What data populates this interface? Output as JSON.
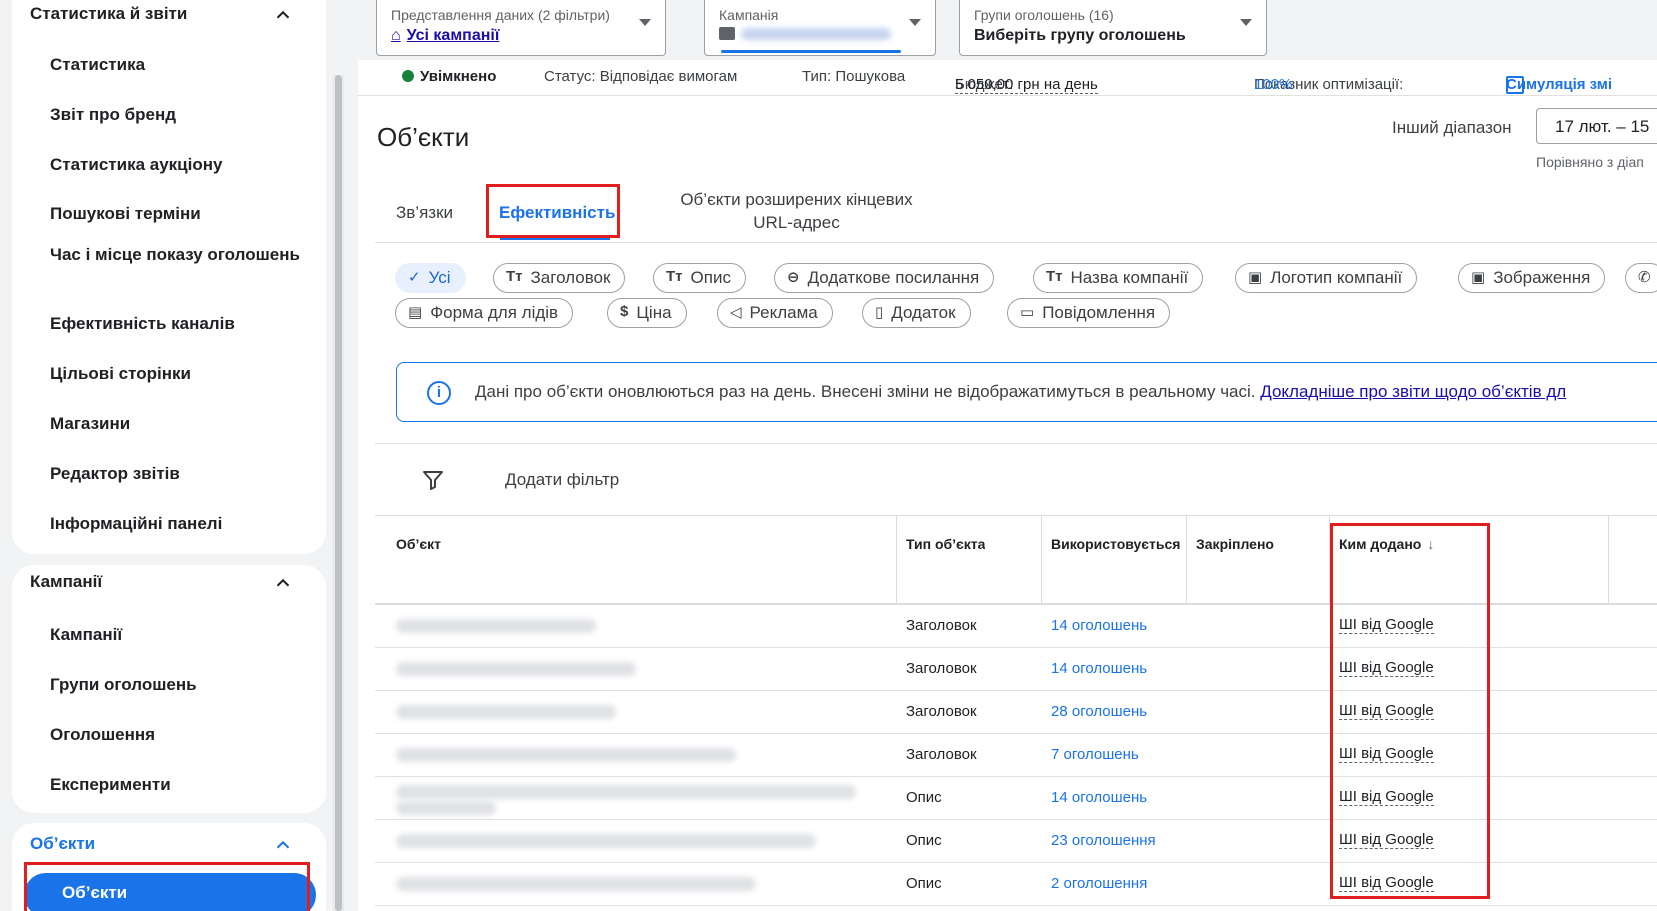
{
  "sidebar": {
    "group1_title": "Статистика й звіти",
    "group1_items": [
      "Статистика",
      "Звіт про бренд",
      "Статистика аукціону",
      "Пошукові терміни",
      "Час і місце показу оголошень",
      "Ефективність каналів",
      "Цільові сторінки",
      "Магазини",
      "Редактор звітів",
      "Інформаційні панелі"
    ],
    "group2_title": "Кампанії",
    "group2_items": [
      "Кампанії",
      "Групи оголошень",
      "Оголошення",
      "Експерименти"
    ],
    "group3_title": "Об’єкти",
    "group3_active": "Об’єкти"
  },
  "filters": {
    "view_label": "Представлення даних (2 фільтри)",
    "view_value": "Усі кампанії",
    "campaign_label": "Кампанія",
    "adgroups_label": "Групи оголошень (16)",
    "adgroups_value": "Виберіть групу оголошень"
  },
  "status": {
    "enabled": "Увімкнено",
    "status_text": "Статус: Відповідає вимогам",
    "type_text": "Тип: Пошукова",
    "budget_label": "Бюджет:",
    "budget_value": "5 050,00 грн на день",
    "optimization_label": "Показник оптимізації:",
    "optimization_value": "100%",
    "simulation": "Симуляція змі"
  },
  "page": {
    "title": "Об’єкти",
    "range_label": "Інший діапазон",
    "range_value": "17 лют. – 15",
    "compare_label": "Порівняно з діап"
  },
  "tabs": {
    "links": "Зв’язки",
    "performance": "Ефективність",
    "extended_url": "Об’єкти розширених кінцевих URL-адрес"
  },
  "chips": {
    "all": "Усі",
    "headline": "Заголовок",
    "description": "Опис",
    "sitelink": "Додаткове посилання",
    "business_name": "Назва компанії",
    "business_logo": "Логотип компанії",
    "image": "Зображення",
    "lead_form": "Форма для лідів",
    "price": "Ціна",
    "promotion": "Реклама",
    "app": "Додаток",
    "message": "Повідомлення"
  },
  "info": {
    "text": "Дані про об’єкти оновлюються раз на день. Внесені зміни не відображатимуться в реальному часі.",
    "link": "Докладніше про звіти щодо об’єктів дл"
  },
  "filter_row": {
    "add_filter": "Додати фільтр"
  },
  "table": {
    "headers": {
      "object": "Об’єкт",
      "type": "Тип об’єкта",
      "used": "Використовується",
      "pinned": "Закріплено",
      "added_by": "Ким додано"
    },
    "rows": [
      {
        "type": "Заголовок",
        "used": "14 оголошень",
        "added_by": "ШІ від Google"
      },
      {
        "type": "Заголовок",
        "used": "14 оголошень",
        "added_by": "ШІ від Google"
      },
      {
        "type": "Заголовок",
        "used": "28 оголошень",
        "added_by": "ШІ від Google"
      },
      {
        "type": "Заголовок",
        "used": "7 оголошень",
        "added_by": "ШІ від Google"
      },
      {
        "type": "Опис",
        "used": "14 оголошень",
        "added_by": "ШІ від Google"
      },
      {
        "type": "Опис",
        "used": "23 оголошення",
        "added_by": "ШІ від Google"
      },
      {
        "type": "Опис",
        "used": "2 оголошення",
        "added_by": "ШІ від Google"
      }
    ]
  },
  "colors": {
    "accent": "#1a73e8",
    "highlight": "#e01e1e",
    "enabled": "#188038"
  }
}
